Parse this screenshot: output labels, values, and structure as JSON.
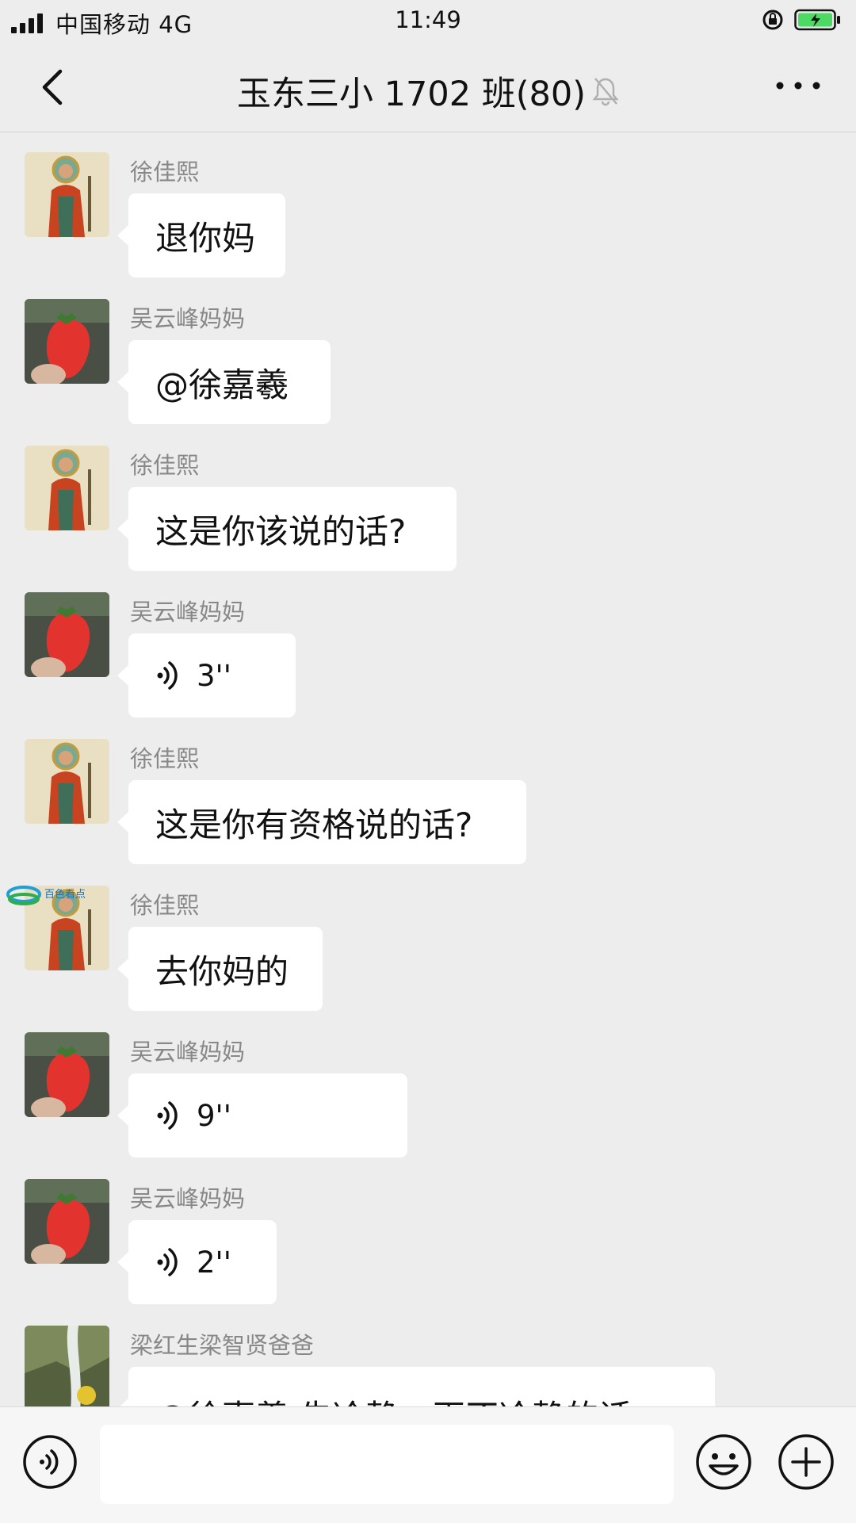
{
  "status": {
    "carrier": "中国移动 4G",
    "time": "11:49"
  },
  "nav": {
    "title": "玉东三小 1702 班(80)",
    "back_icon": "chevron-left-icon",
    "mute_icon": "bell-off-icon",
    "more_icon": "more-dots-icon"
  },
  "messages": [
    {
      "sender": "徐佳熙",
      "avatar": "buddha-painting",
      "type": "text",
      "text": "退你妈"
    },
    {
      "sender": "吴云峰妈妈",
      "avatar": "strawberry",
      "type": "text",
      "text": "@徐嘉羲"
    },
    {
      "sender": "徐佳熙",
      "avatar": "buddha-painting",
      "type": "text",
      "text": "这是你该说的话?"
    },
    {
      "sender": "吴云峰妈妈",
      "avatar": "strawberry",
      "type": "voice",
      "text": "3''"
    },
    {
      "sender": "徐佳熙",
      "avatar": "buddha-painting",
      "type": "text",
      "text": "这是你有资格说的话?"
    },
    {
      "sender": "徐佳熙",
      "avatar": "buddha-painting",
      "type": "text",
      "text": "去你妈的"
    },
    {
      "sender": "吴云峰妈妈",
      "avatar": "strawberry",
      "type": "voice",
      "text": "9''"
    },
    {
      "sender": "吴云峰妈妈",
      "avatar": "strawberry",
      "type": "voice",
      "text": "2''"
    },
    {
      "sender": "梁红生梁智贤爸爸",
      "avatar": "waterfall-photo",
      "type": "text",
      "text": "@徐嘉羲 先冷静，再不冷静的话"
    }
  ],
  "watermark": {
    "text": "百色看点"
  },
  "input_bar": {
    "voice_icon": "voice-icon",
    "emoji_icon": "smiley-icon",
    "plus_icon": "plus-icon",
    "input_value": ""
  }
}
